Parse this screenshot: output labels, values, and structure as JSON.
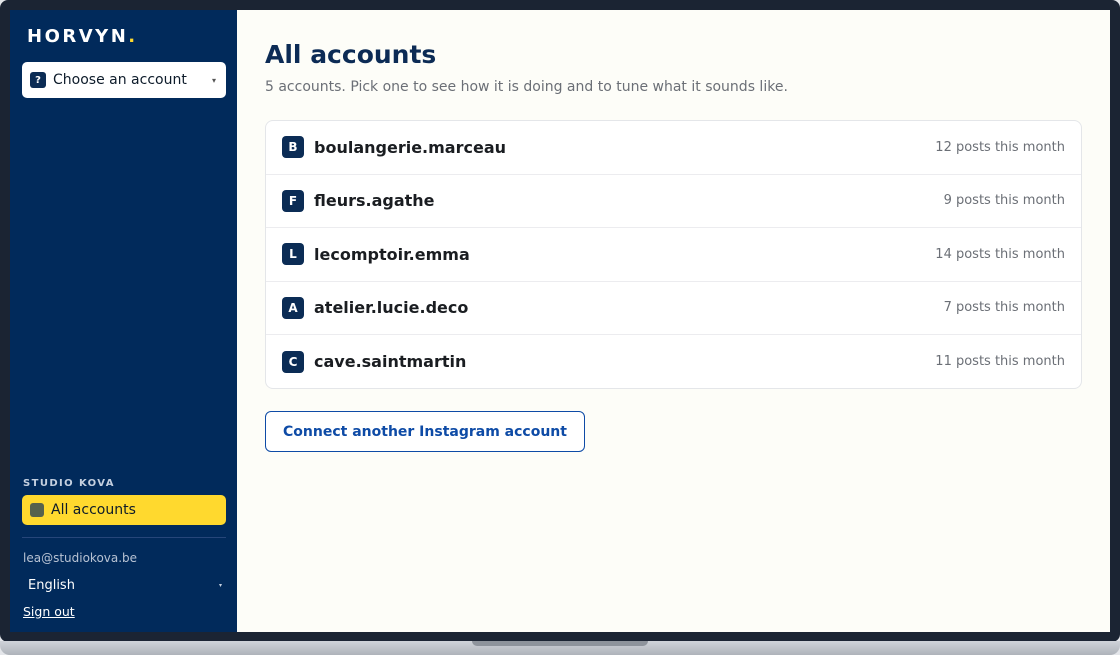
{
  "brand": {
    "name": "HORVYN",
    "dot": ".",
    "accent": "#ffd92e"
  },
  "sidebar": {
    "account_select": {
      "badge": "?",
      "label": "Choose an account",
      "caret": "▾"
    },
    "team_label": "STUDIO KOVA",
    "nav_all_label": "All accounts",
    "user_email": "lea@studiokova.be",
    "language": "English",
    "language_caret": "▾",
    "sign_out": "Sign out"
  },
  "main": {
    "title": "All accounts",
    "subtitle": "5 accounts. Pick one to see how it is doing and to tune what it sounds like.",
    "accounts": [
      {
        "initial": "B",
        "name": "boulangerie.marceau",
        "meta": "12 posts this month"
      },
      {
        "initial": "F",
        "name": "fleurs.agathe",
        "meta": "9 posts this month"
      },
      {
        "initial": "L",
        "name": "lecomptoir.emma",
        "meta": "14 posts this month"
      },
      {
        "initial": "A",
        "name": "atelier.lucie.deco",
        "meta": "7 posts this month"
      },
      {
        "initial": "C",
        "name": "cave.saintmartin",
        "meta": "11 posts this month"
      }
    ],
    "connect_button": "Connect another Instagram account"
  },
  "colors": {
    "sidebar_bg": "#012a5b",
    "accent_yellow": "#ffd92e",
    "primary_blue": "#0e4ba6",
    "badge_navy": "#0b2c55"
  }
}
